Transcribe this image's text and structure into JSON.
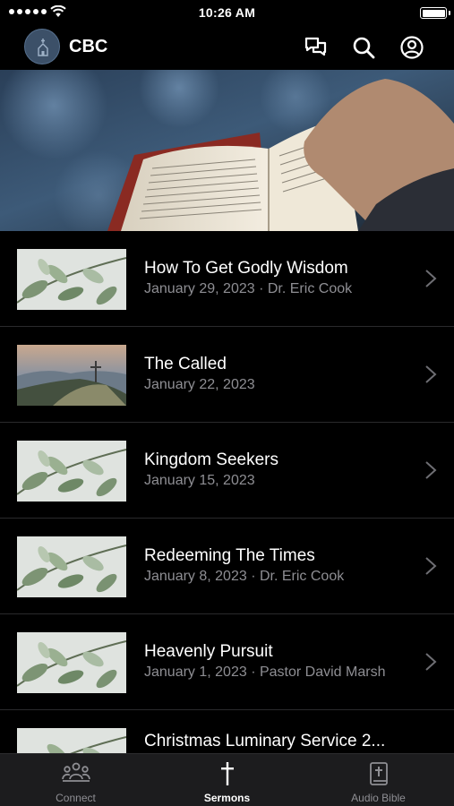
{
  "status_bar": {
    "time": "10:26 AM"
  },
  "header": {
    "title": "CBC"
  },
  "sermons": [
    {
      "title": "How To Get Godly Wisdom",
      "subtitle": "January 29, 2023 · Dr. Eric Cook",
      "thumbnail": "plant-leaves"
    },
    {
      "title": "The Called",
      "subtitle": "January 22, 2023",
      "thumbnail": "mountain-cross"
    },
    {
      "title": "Kingdom Seekers",
      "subtitle": "January 15, 2023",
      "thumbnail": "plant-leaves"
    },
    {
      "title": "Redeeming The Times",
      "subtitle": "January 8, 2023 · Dr. Eric Cook",
      "thumbnail": "plant-leaves"
    },
    {
      "title": "Heavenly Pursuit",
      "subtitle": "January 1, 2023 · Pastor David Marsh",
      "thumbnail": "plant-leaves"
    },
    {
      "title": "Christmas Luminary Service 2...",
      "subtitle": "",
      "thumbnail": "plant-leaves"
    }
  ],
  "tabs": [
    {
      "label": "Connect",
      "icon": "people-icon",
      "active": false
    },
    {
      "label": "Sermons",
      "icon": "cross-icon",
      "active": true
    },
    {
      "label": "Audio Bible",
      "icon": "bible-icon",
      "active": false
    }
  ],
  "colors": {
    "background": "#000000",
    "secondary_text": "#8e8e93",
    "tabbar": "#1c1c1e"
  }
}
